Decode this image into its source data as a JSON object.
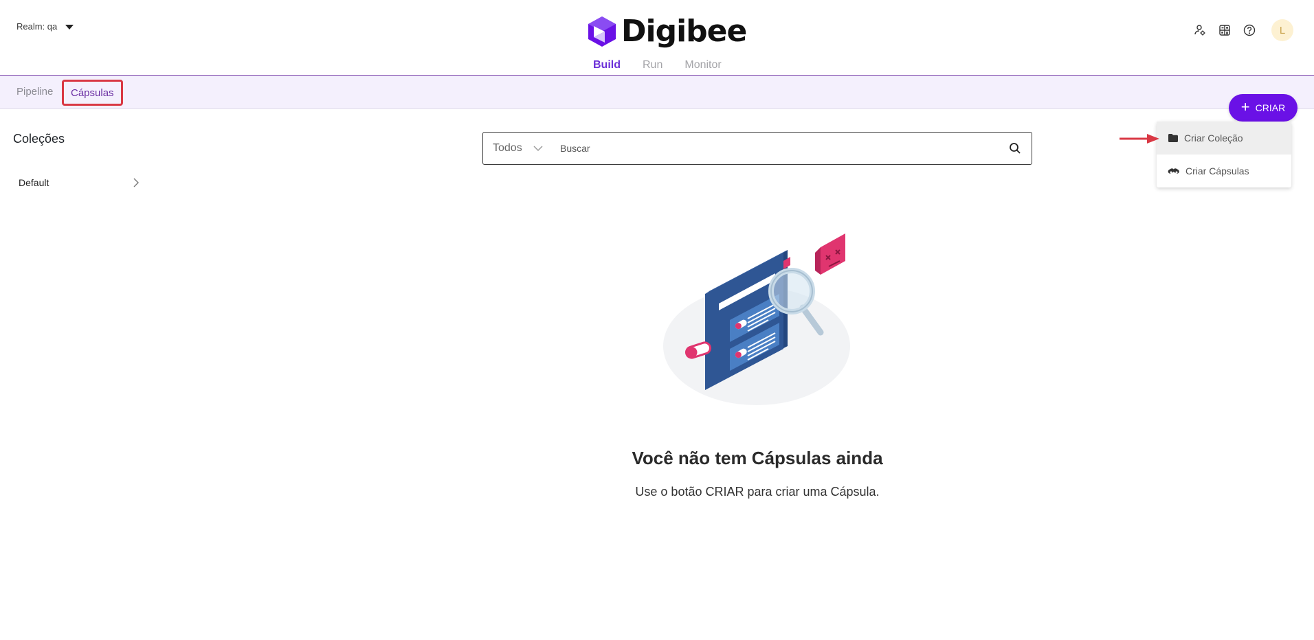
{
  "header": {
    "realm_label": "Realm: qa",
    "brand": "Digibee",
    "tabs": [
      "Build",
      "Run",
      "Monitor"
    ],
    "avatar_initial": "L",
    "icons": [
      "user-settings-icon",
      "calculator-icon",
      "help-icon"
    ]
  },
  "subnav": {
    "tabs": [
      "Pipeline",
      "Cápsulas"
    ],
    "active": "Cápsulas"
  },
  "create": {
    "label": "CRIAR",
    "menu": [
      {
        "label": "Criar Coleção",
        "icon": "folder-icon"
      },
      {
        "label": "Criar Cápsulas",
        "icon": "capsule-icon"
      }
    ]
  },
  "sidebar": {
    "title": "Coleções",
    "items": [
      {
        "label": "Default"
      }
    ]
  },
  "search": {
    "filter_value": "Todos",
    "placeholder": "Buscar"
  },
  "empty_state": {
    "title": "Você não tem Cápsulas ainda",
    "subtitle": "Use o botão CRIAR para criar uma Cápsula."
  },
  "colors": {
    "brand_purple": "#6a11e6",
    "accent_pink": "#e0356f",
    "highlight_red": "#d93844",
    "illustration_navy": "#2a4f8a"
  }
}
